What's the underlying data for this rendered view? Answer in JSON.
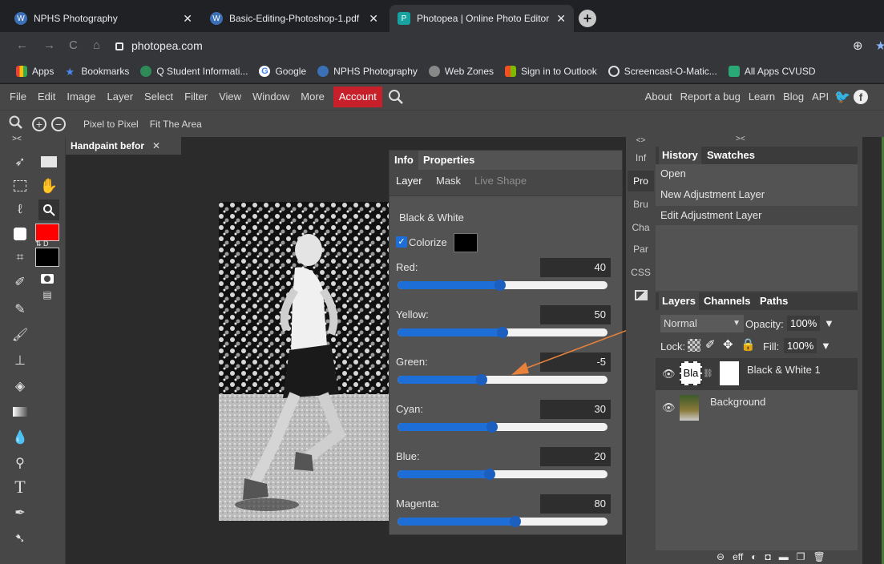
{
  "browser": {
    "tabs": [
      {
        "title": "NPHS Photography"
      },
      {
        "title": "Basic-Editing-Photoshop-1.pdf"
      },
      {
        "title": "Photopea | Online Photo Editor"
      }
    ],
    "url": "photopea.com",
    "bookmarks": [
      "Apps",
      "Bookmarks",
      "Q Student Informati...",
      "Google",
      "NPHS Photography",
      "Web Zones",
      "Sign in to Outlook",
      "Screencast-O-Matic...",
      "All Apps CVUSD"
    ]
  },
  "menubar": {
    "items": [
      "File",
      "Edit",
      "Image",
      "Layer",
      "Select",
      "Filter",
      "View",
      "Window",
      "More"
    ],
    "account": "Account",
    "right": [
      "About",
      "Report a bug",
      "Learn",
      "Blog",
      "API"
    ]
  },
  "options": {
    "pixel_to_pixel": "Pixel to Pixel",
    "fit_area": "Fit The Area"
  },
  "document": {
    "tab_title": "Handpaint befor"
  },
  "properties": {
    "tabs": [
      "Info",
      "Properties"
    ],
    "subtabs": [
      "Layer",
      "Mask",
      "Live Shape"
    ],
    "adjustment_name": "Black & White",
    "colorize_label": "Colorize",
    "sliders": [
      {
        "label": "Red:",
        "value": "40",
        "fill": 0.49
      },
      {
        "label": "Yellow:",
        "value": "50",
        "fill": 0.5
      },
      {
        "label": "Green:",
        "value": "-5",
        "fill": 0.4
      },
      {
        "label": "Cyan:",
        "value": "30",
        "fill": 0.45
      },
      {
        "label": "Blue:",
        "value": "20",
        "fill": 0.44
      },
      {
        "label": "Magenta:",
        "value": "80",
        "fill": 0.56
      }
    ]
  },
  "icon_strip": [
    "Inf",
    "Pro",
    "Bru",
    "Cha",
    "Par",
    "CSS"
  ],
  "history": {
    "tabs": [
      "History",
      "Swatches"
    ],
    "items": [
      "Open",
      "New Adjustment Layer",
      "Edit Adjustment Layer"
    ]
  },
  "layers": {
    "tabs": [
      "Layers",
      "Channels",
      "Paths"
    ],
    "blend_mode": "Normal",
    "opacity_label": "Opacity:",
    "opacity": "100%",
    "lock_label": "Lock:",
    "fill_label": "Fill:",
    "fill": "100%",
    "items": [
      {
        "name": "Black & White 1",
        "thumb_text": "Bla"
      },
      {
        "name": "Background"
      }
    ],
    "footer_link": "eff"
  },
  "colors": {
    "foreground": "#ff0000",
    "background": "#000000",
    "account_red": "#c8202b",
    "slider_blue": "#1d6ed6",
    "arrow_orange": "#e8823a"
  }
}
